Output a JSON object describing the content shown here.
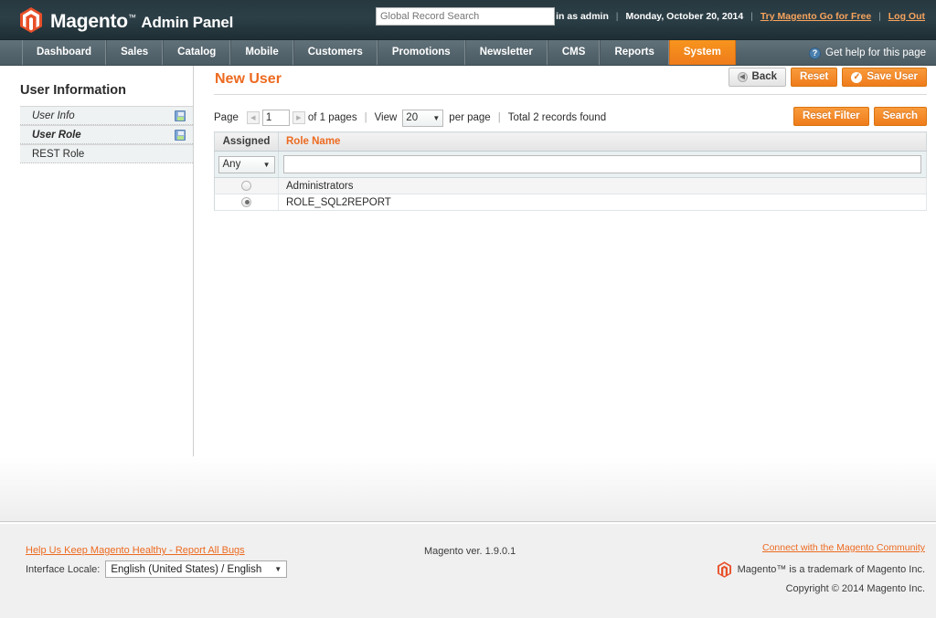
{
  "header": {
    "logo_text": "Magento",
    "logo_tm": "™",
    "logo_sub": "Admin Panel",
    "search_placeholder": "Global Record Search",
    "search_value": "",
    "logged_in_as": "Logged in as admin",
    "date": "Monday, October 20, 2014",
    "try_link": "Try Magento Go for Free",
    "logout_link": "Log Out",
    "separator": "|"
  },
  "nav": {
    "items": [
      {
        "label": "Dashboard",
        "active": false
      },
      {
        "label": "Sales",
        "active": false
      },
      {
        "label": "Catalog",
        "active": false
      },
      {
        "label": "Mobile",
        "active": false
      },
      {
        "label": "Customers",
        "active": false
      },
      {
        "label": "Promotions",
        "active": false
      },
      {
        "label": "Newsletter",
        "active": false
      },
      {
        "label": "CMS",
        "active": false
      },
      {
        "label": "Reports",
        "active": false
      },
      {
        "label": "System",
        "active": true
      }
    ],
    "help_label": "Get help for this page",
    "help_icon": "question-mark-icon",
    "help_glyph": "?"
  },
  "sidebar": {
    "title": "User Information",
    "items": [
      {
        "label": "User Info",
        "has_save_icon": true
      },
      {
        "label": "User Role",
        "has_save_icon": true
      },
      {
        "label": "REST Role",
        "has_save_icon": false
      }
    ]
  },
  "main": {
    "page_title": "New User",
    "buttons": {
      "back": "Back",
      "reset": "Reset",
      "save": "Save User"
    },
    "pager": {
      "page_label": "Page",
      "page_value": "1",
      "of_pages": "of 1 pages",
      "view_label": "View",
      "per_page_value": "20",
      "per_page_label": "per page",
      "total_label": "Total 2 records found",
      "reset_filter": "Reset Filter",
      "search": "Search",
      "pipe": "|"
    },
    "grid": {
      "columns": [
        {
          "label": "Assigned",
          "sorted": false
        },
        {
          "label": "Role Name",
          "sorted": true
        }
      ],
      "filters": {
        "assigned_value": "Any",
        "role_name_value": ""
      },
      "rows": [
        {
          "assigned": false,
          "role_name": "Administrators"
        },
        {
          "assigned": true,
          "role_name": "ROLE_SQL2REPORT"
        }
      ]
    }
  },
  "footer": {
    "bugs_link": "Help Us Keep Magento Healthy - Report All Bugs",
    "locale_label": "Interface Locale:",
    "locale_value": "English (United States) / English",
    "version": "Magento ver. 1.9.0.1",
    "community_link": "Connect with the Magento Community",
    "trademark": "Magento™ is a trademark of Magento Inc.",
    "copyright": "Copyright © 2014 Magento Inc."
  },
  "colors": {
    "accent_orange": "#ed6a20",
    "header_dark": "#2c3f47",
    "nav_gray": "#55656d",
    "link_orange": "#f7a35c"
  }
}
